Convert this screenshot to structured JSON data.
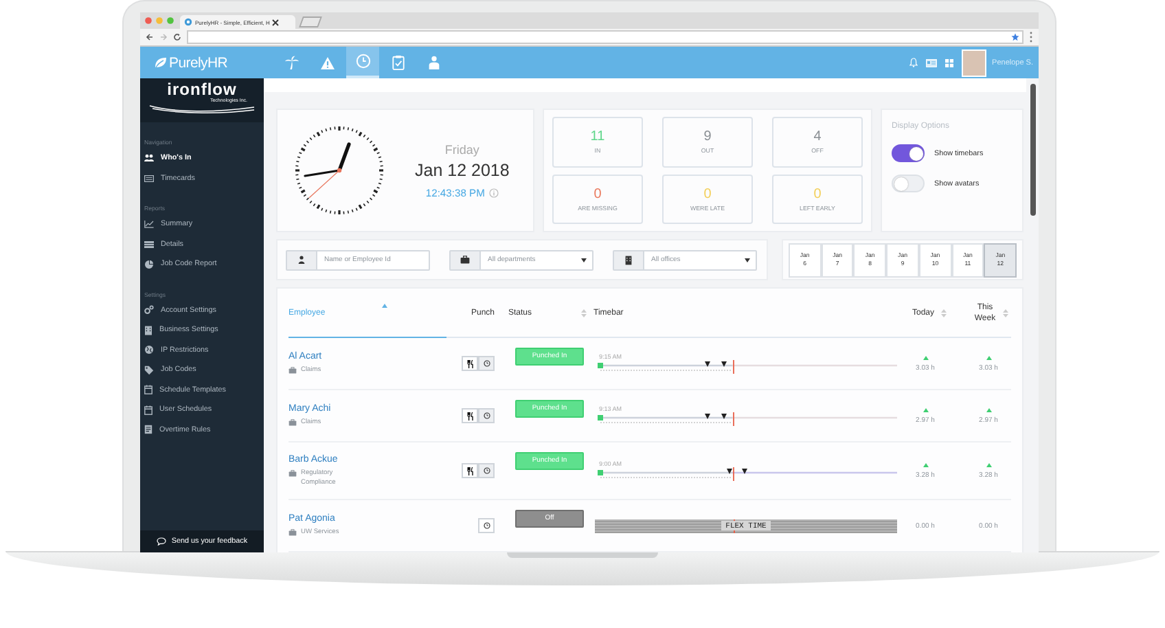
{
  "browser": {
    "tab_title": "PurelyHR - Simple, Efficient, H"
  },
  "header": {
    "logo": "PurelyHR",
    "nav": [
      {
        "kind": "palm",
        "selected": false
      },
      {
        "kind": "warning",
        "selected": false
      },
      {
        "kind": "clock",
        "selected": true
      },
      {
        "kind": "clipboard",
        "selected": false
      },
      {
        "kind": "person",
        "selected": false
      }
    ],
    "user": "Penelope S."
  },
  "sidebar": {
    "logo": "ironflow",
    "logo_sub": "Technologies Inc.",
    "sections": [
      {
        "title": "Navigation",
        "items": [
          {
            "label": "Who's In",
            "kind": "people",
            "selected": true
          },
          {
            "label": "Timecards",
            "kind": "card",
            "selected": false
          }
        ]
      },
      {
        "title": "Reports",
        "items": [
          {
            "label": "Summary",
            "kind": "chart",
            "selected": false
          },
          {
            "label": "Details",
            "kind": "list",
            "selected": false
          },
          {
            "label": "Job Code Report",
            "kind": "pie",
            "selected": false
          }
        ]
      },
      {
        "title": "Settings",
        "items": [
          {
            "label": "Account Settings",
            "kind": "gears",
            "selected": false
          },
          {
            "label": "Business Settings",
            "kind": "building",
            "selected": false
          },
          {
            "label": "IP Restrictions",
            "kind": "globe",
            "selected": false
          },
          {
            "label": "Job Codes",
            "kind": "tag",
            "selected": false
          },
          {
            "label": "Schedule Templates",
            "kind": "calendar",
            "selected": false
          },
          {
            "label": "User Schedules",
            "kind": "calendar",
            "selected": false
          },
          {
            "label": "Overtime Rules",
            "kind": "document",
            "selected": false
          }
        ]
      }
    ],
    "feedback": "Send us your feedback"
  },
  "clock": {
    "day": "Friday",
    "date": "Jan 12 2018",
    "time": "12:43:38 PM"
  },
  "stats": [
    {
      "value": "11",
      "label": "IN",
      "color": "#5fd68a"
    },
    {
      "value": "9",
      "label": "OUT",
      "color": "#8a8f94"
    },
    {
      "value": "4",
      "label": "OFF",
      "color": "#8a8f94"
    },
    {
      "value": "0",
      "label": "ARE MISSING",
      "color": "#ea7a5e"
    },
    {
      "value": "0",
      "label": "WERE LATE",
      "color": "#f3cf5a"
    },
    {
      "value": "0",
      "label": "LEFT EARLY",
      "color": "#f3cf5a"
    }
  ],
  "display_options": {
    "title": "Display Options",
    "toggles": [
      {
        "label": "Show timebars",
        "on": true
      },
      {
        "label": "Show avatars",
        "on": false
      }
    ]
  },
  "filters": [
    {
      "kind": "person",
      "placeholder": "Name or Employee Id",
      "dropdown": false
    },
    {
      "kind": "department",
      "placeholder": "All departments",
      "dropdown": true
    },
    {
      "kind": "office",
      "placeholder": "All offices",
      "dropdown": true
    }
  ],
  "dates": [
    {
      "month": "Jan",
      "day": "6",
      "selected": false
    },
    {
      "month": "Jan",
      "day": "7",
      "selected": false
    },
    {
      "month": "Jan",
      "day": "8",
      "selected": false
    },
    {
      "month": "Jan",
      "day": "9",
      "selected": false
    },
    {
      "month": "Jan",
      "day": "10",
      "selected": false
    },
    {
      "month": "Jan",
      "day": "11",
      "selected": false
    },
    {
      "month": "Jan",
      "day": "12",
      "selected": true
    }
  ],
  "table": {
    "columns": [
      {
        "label": "Employee",
        "selected": true,
        "kind": "sorted"
      },
      {
        "label": "Punch",
        "selected": false,
        "kind": "plain"
      },
      {
        "label": "Status",
        "selected": false,
        "kind": "sortable"
      },
      {
        "label": "Timebar",
        "selected": false,
        "kind": "plain"
      },
      {
        "label": "Today",
        "selected": false,
        "kind": "sortable"
      },
      {
        "label": "This Week",
        "selected": false,
        "kind": "sortable"
      }
    ],
    "rows": [
      {
        "name": "Al Acart",
        "department": "Claims",
        "kind": "break_and_clock",
        "status": {
          "kind": "in",
          "label": "Punched In"
        },
        "timebar": {
          "kind": "shift",
          "start": "9:15 AM"
        },
        "today": {
          "value": "3.03 h",
          "up": true
        },
        "week": {
          "value": "3.03 h",
          "up": true
        }
      },
      {
        "name": "Mary Achi",
        "department": "Claims",
        "kind": "break_and_clock",
        "status": {
          "kind": "in",
          "label": "Punched In"
        },
        "timebar": {
          "kind": "shift",
          "start": "9:13 AM"
        },
        "today": {
          "value": "2.97 h",
          "up": true
        },
        "week": {
          "value": "2.97 h",
          "up": true
        }
      },
      {
        "name": "Barb Ackue",
        "department": "Regulatory Compliance",
        "kind": "break_and_clock",
        "status": {
          "kind": "in",
          "label": "Punched In"
        },
        "timebar": {
          "kind": "shift",
          "start": "9:00 AM"
        },
        "today": {
          "value": "3.28 h",
          "up": true
        },
        "week": {
          "value": "3.28 h",
          "up": true
        }
      },
      {
        "name": "Pat Agonia",
        "department": "UW Services",
        "kind": "clock_only",
        "status": {
          "kind": "off",
          "label": "Off"
        },
        "timebar": {
          "kind": "flex",
          "label": "FLEX TIME"
        },
        "today": {
          "value": "0.00 h",
          "up": false
        },
        "week": {
          "value": "0.00 h",
          "up": false
        }
      }
    ]
  }
}
